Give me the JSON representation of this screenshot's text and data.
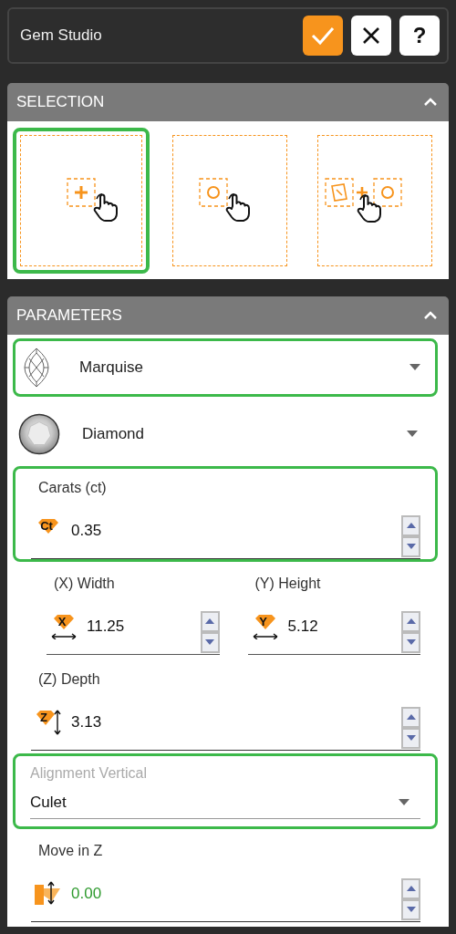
{
  "header": {
    "title": "Gem Studio",
    "buttons": [
      {
        "kind": "confirm"
      },
      {
        "kind": "cancel"
      },
      {
        "kind": "help",
        "label": "?"
      }
    ]
  },
  "selection": {
    "title": "SELECTION",
    "expanded": true,
    "options": [
      {
        "kind": "add",
        "selected": true
      },
      {
        "kind": "pick",
        "selected": false
      },
      {
        "kind": "combine",
        "selected": false
      }
    ]
  },
  "parameters": {
    "title": "PARAMETERS",
    "expanded": true,
    "fields": [
      {
        "kind": "shape",
        "value": "Marquise",
        "highlighted": true
      },
      {
        "kind": "material",
        "value": "Diamond",
        "highlighted": false
      },
      {
        "kind": "carat",
        "label": "Carats (ct)",
        "badge": "Ct",
        "value": "0.35",
        "modified": false,
        "highlighted": true
      },
      {
        "kind": "pair",
        "highlighted": false,
        "items": [
          {
            "label": "(X) Width",
            "badge": "X",
            "value": "11.25",
            "modified": false
          },
          {
            "label": "(Y) Height",
            "badge": "Y",
            "value": "5.12",
            "modified": false
          }
        ]
      },
      {
        "kind": "depth",
        "label": "(Z) Depth",
        "badge": "Z",
        "value": "3.13",
        "modified": false,
        "highlighted": false
      },
      {
        "kind": "select",
        "label": "Alignment Vertical",
        "value": "Culet",
        "highlighted": true
      },
      {
        "kind": "move",
        "label": "Move in Z",
        "value": "0.00",
        "modified": true,
        "highlighted": false
      }
    ]
  }
}
